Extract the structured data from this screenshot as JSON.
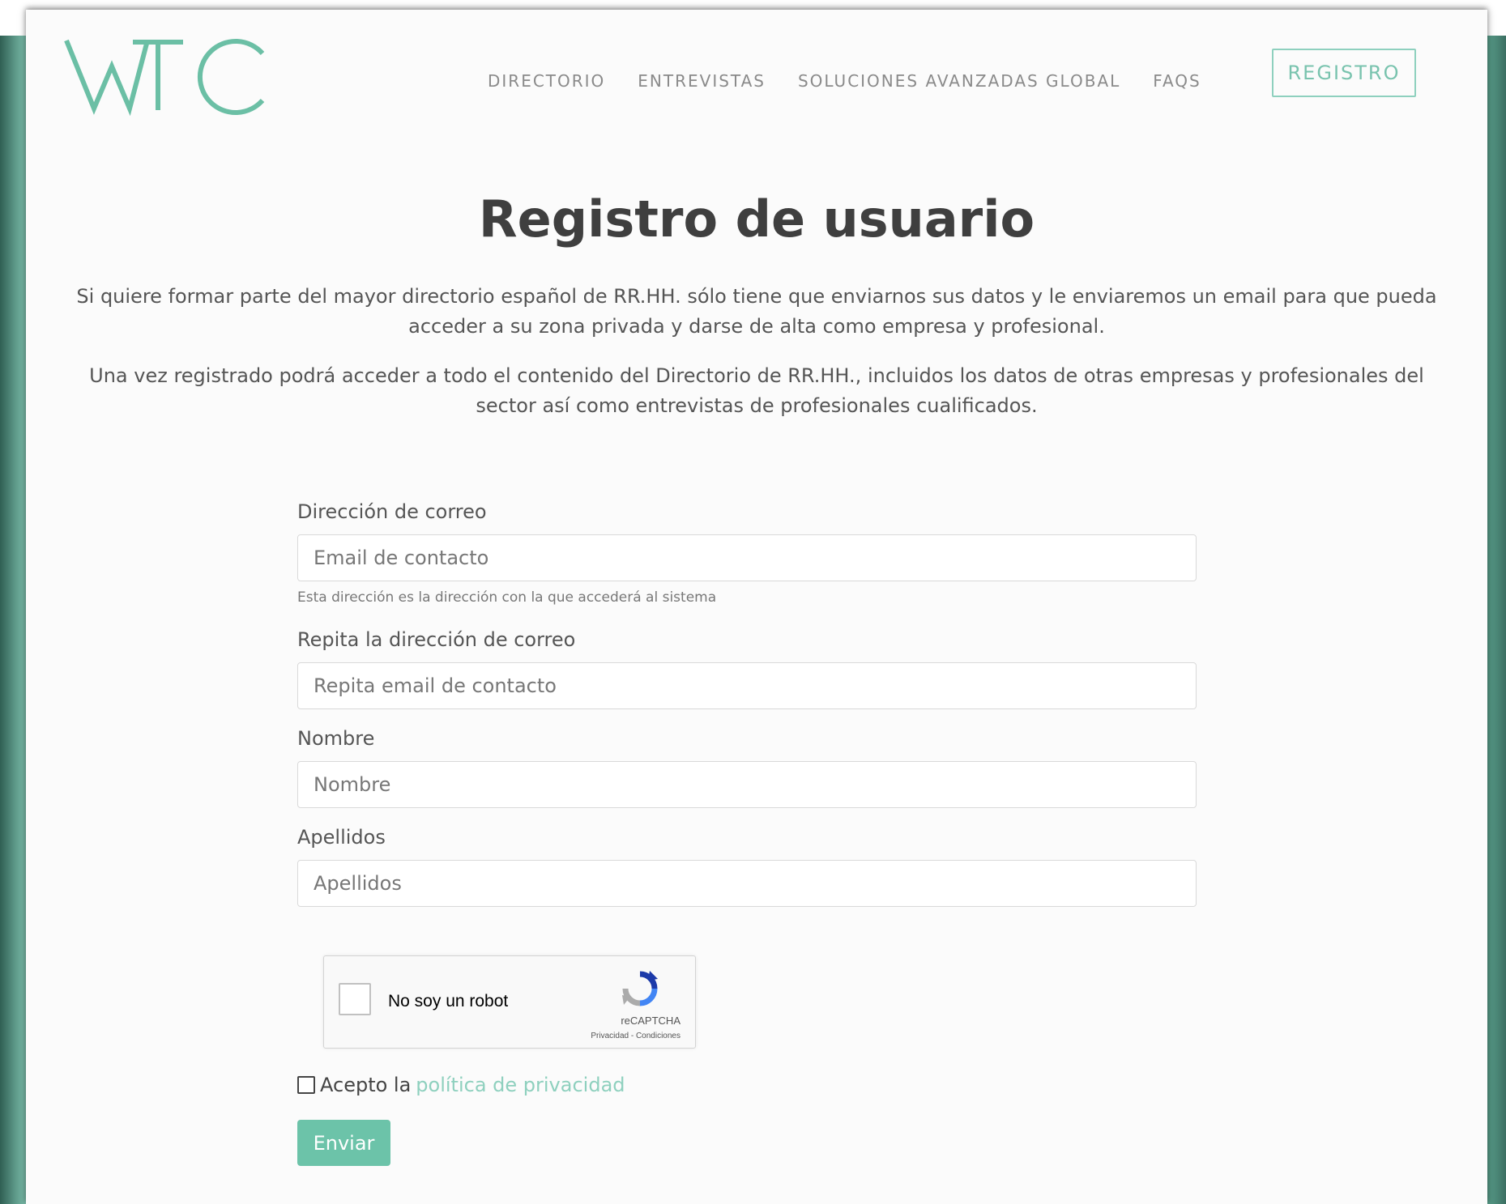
{
  "brand": {
    "logo_text": "WTC",
    "accent_color": "#7ec1ae"
  },
  "nav": {
    "items": [
      "DIRECTORIO",
      "ENTREVISTAS",
      "SOLUCIONES AVANZADAS GLOBAL",
      "FAQS"
    ],
    "register_label": "REGISTRO"
  },
  "main": {
    "title": "Registro de usuario",
    "intro_1": "Si quiere formar parte del mayor directorio español de RR.HH. sólo tiene que enviarnos sus datos y le enviaremos un email para que pueda acceder a su zona privada y darse de alta como empresa y profesional.",
    "intro_2": "Una vez registrado podrá acceder a todo el contenido del Directorio de RR.HH., incluidos los datos de otras empresas y profesionales del sector así como entrevistas de profesionales cualificados."
  },
  "form": {
    "email": {
      "label": "Dirección de correo",
      "placeholder": "Email de contacto",
      "help": "Esta dirección es la dirección con la que accederá al sistema"
    },
    "email_repeat": {
      "label": "Repita la dirección de correo",
      "placeholder": "Repita email de contacto"
    },
    "first_name": {
      "label": "Nombre",
      "placeholder": "Nombre"
    },
    "last_name": {
      "label": "Apellidos",
      "placeholder": "Apellidos"
    },
    "recaptcha": {
      "label": "No soy un robot",
      "brand": "reCAPTCHA",
      "links": "Privacidad - Condiciones"
    },
    "consent": {
      "prefix": "Acepto la",
      "link_text": "política de privacidad"
    },
    "submit_label": "Enviar"
  }
}
